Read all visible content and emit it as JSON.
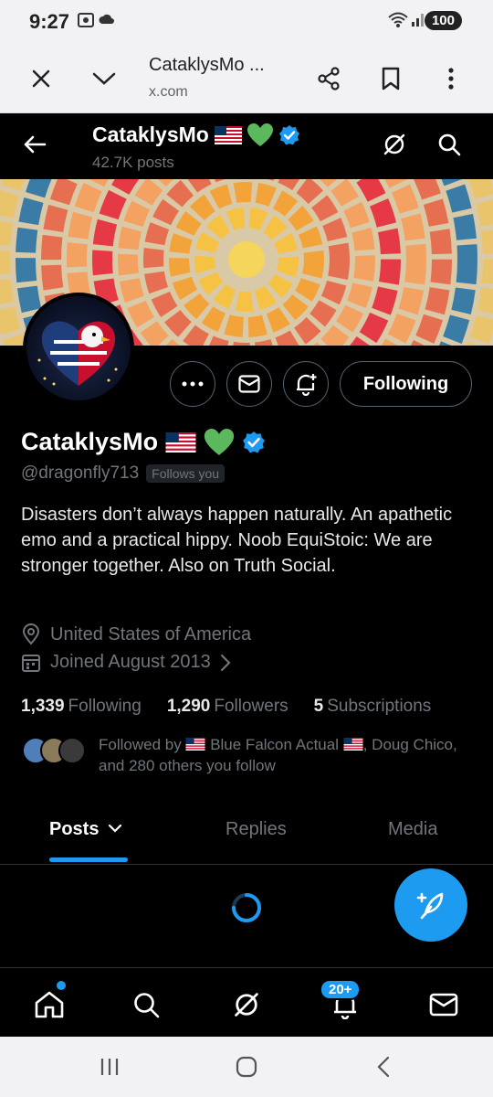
{
  "status_bar": {
    "time": "9:27",
    "battery": "100"
  },
  "browser": {
    "title": "CataklysMo ...",
    "url": "x.com"
  },
  "header": {
    "name": "CataklysMo",
    "posts": "42.7K posts"
  },
  "actions": {
    "following_label": "Following"
  },
  "profile": {
    "name": "CataklysMo",
    "handle": "@dragonfly713",
    "follows_you": "Follows you",
    "bio": "Disasters don’t always happen naturally. An apathetic emo and a practical hippy. Noob EquiStoic: We are stronger together. Also on Truth Social.",
    "location": "United States of America",
    "joined": "Joined August 2013"
  },
  "counts": {
    "following_num": "1,339",
    "following_label": "Following",
    "followers_num": "1,290",
    "followers_label": "Followers",
    "subs_num": "5",
    "subs_label": "Subscriptions"
  },
  "followed_by": {
    "prefix": "Followed by",
    "name1": "Blue Falcon Actual",
    "rest": ", Doug Chico, and 280 others you follow"
  },
  "tabs": [
    {
      "label": "Posts"
    },
    {
      "label": "Replies"
    },
    {
      "label": "Media"
    }
  ],
  "nav": {
    "notifications_badge": "20+"
  },
  "colors": {
    "accent": "#1d9bf0",
    "verified": "#1d9bf0",
    "heart": "#5cb85c"
  }
}
